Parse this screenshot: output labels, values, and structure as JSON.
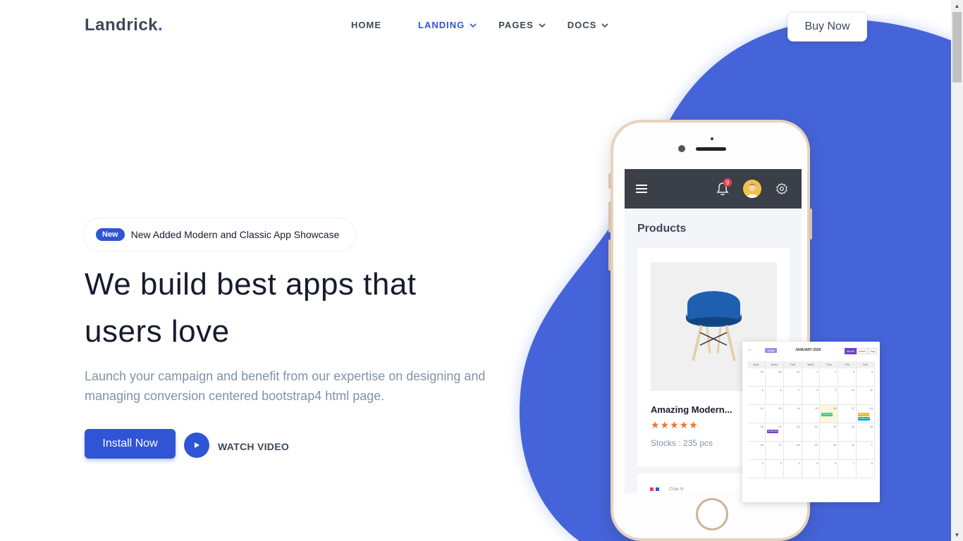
{
  "header": {
    "logo": "Landrick",
    "logo_dot": ".",
    "nav": [
      {
        "label": "HOME"
      },
      {
        "label": "LANDING"
      },
      {
        "label": "PAGES"
      },
      {
        "label": "DOCS"
      }
    ],
    "buy_label": "Buy Now"
  },
  "hero": {
    "badge": "New",
    "badge_text": "New Added Modern and Classic App Showcase",
    "title_line1": "We build best apps that",
    "title_line2": "users love",
    "subtitle": "Launch your campaign and benefit from our expertise on designing and managing conversion centered bootstrap4 html page.",
    "install_label": "Install Now",
    "watch_label": "WATCH VIDEO"
  },
  "phone_app": {
    "notification_count": "9",
    "products_title": "Products",
    "product_name": "Amazing Modern...",
    "rating": 5,
    "stock": "Stocks : 235 pcs",
    "second_card_label": "Chair N"
  },
  "calendar": {
    "month": "JANUARY 2020",
    "today_label": "Today",
    "views": [
      "Month",
      "Week",
      "Day"
    ],
    "dow": [
      "SUN",
      "MON",
      "TUE",
      "WED",
      "THU",
      "FRI",
      "SAT"
    ],
    "weeks": [
      [
        "29",
        "30",
        "31",
        "1",
        "2",
        "3",
        "4"
      ],
      [
        "5",
        "6",
        "7",
        "8",
        "9",
        "10",
        "11"
      ],
      [
        "12",
        "13",
        "14",
        "15",
        "16",
        "17",
        "18"
      ],
      [
        "19",
        "20",
        "21",
        "22",
        "23",
        "24",
        "25"
      ],
      [
        "26",
        "27",
        "28",
        "29",
        "30",
        "31",
        "1"
      ],
      [
        "2",
        "3",
        "4",
        "5",
        "6",
        "7",
        "8"
      ]
    ],
    "events": [
      {
        "label": "12:45p 1st",
        "color": "#2eca8b"
      },
      {
        "label": "8:00a 2nd",
        "color": "#f4b400"
      },
      {
        "label": "12:45p 2nd",
        "color": "#17a2b8"
      },
      {
        "label": "10:30a 3rd",
        "color": "#6f42c1"
      }
    ]
  },
  "colors": {
    "primary": "#2f55d4",
    "blob": "#4664d9"
  }
}
